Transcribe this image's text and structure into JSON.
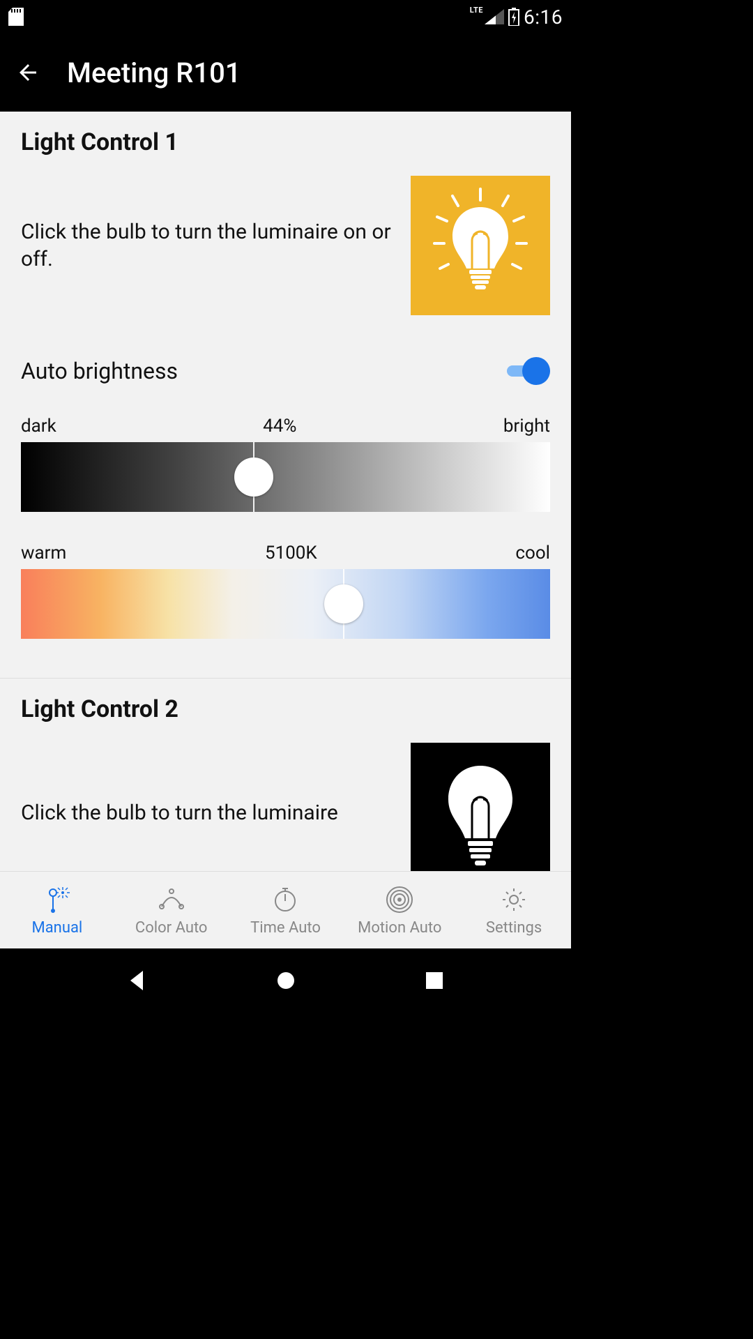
{
  "status": {
    "time": "6:16",
    "network": "LTE"
  },
  "header": {
    "title": "Meeting R101"
  },
  "controls": [
    {
      "title": "Light Control 1",
      "instruction": "Click the bulb to turn the luminaire on or off.",
      "bulb_on": true,
      "auto_brightness_label": "Auto brightness",
      "auto_brightness": true,
      "brightness": {
        "left": "dark",
        "value": "44%",
        "right": "bright",
        "pct": 44
      },
      "temperature": {
        "left": "warm",
        "value": "5100K",
        "right": "cool",
        "pct": 61
      }
    },
    {
      "title": "Light Control 2",
      "instruction": "Click the bulb to turn the luminaire",
      "bulb_on": false
    }
  ],
  "nav": {
    "items": [
      {
        "label": "Manual"
      },
      {
        "label": "Color Auto"
      },
      {
        "label": "Time Auto"
      },
      {
        "label": "Motion Auto"
      },
      {
        "label": "Settings"
      }
    ],
    "active": 0
  },
  "colors": {
    "accent": "#1a73e8",
    "bulb_on_bg": "#f0b429"
  }
}
